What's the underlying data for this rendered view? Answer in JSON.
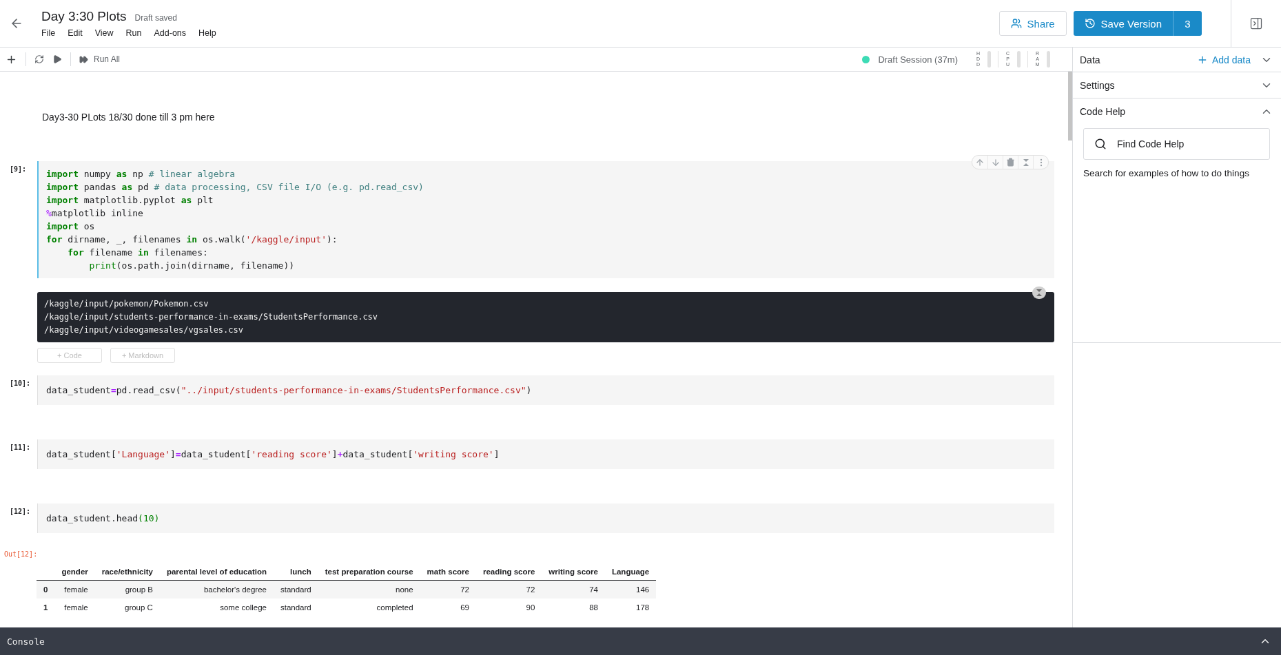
{
  "header": {
    "title": "Day 3:30 Plots",
    "status": "Draft saved",
    "menu": [
      "File",
      "Edit",
      "View",
      "Run",
      "Add-ons",
      "Help"
    ],
    "share": "Share",
    "save_version": "Save Version",
    "version_count": "3"
  },
  "toolbar": {
    "run_all": "Run All",
    "session": "Draft Session (37m)",
    "meters": [
      {
        "label": "HDD",
        "level": 0
      },
      {
        "label": "CPU",
        "level": 0
      },
      {
        "label": "RAM",
        "level": 0
      }
    ]
  },
  "cells": [
    {
      "kind": "markdown",
      "text": "Day3-30 PLots 18/30 done till 3 pm here"
    },
    {
      "kind": "code",
      "prompt": "[9]:",
      "active": true,
      "lines": [
        {
          "tokens": [
            {
              "kind": "kw",
              "text": "import"
            },
            {
              "kind": "p",
              "text": " numpy "
            },
            {
              "kind": "kw",
              "text": "as"
            },
            {
              "kind": "p",
              "text": " np "
            },
            {
              "kind": "c",
              "text": "# linear algebra"
            }
          ]
        },
        {
          "tokens": [
            {
              "kind": "kw",
              "text": "import"
            },
            {
              "kind": "p",
              "text": " pandas "
            },
            {
              "kind": "kw",
              "text": "as"
            },
            {
              "kind": "p",
              "text": " pd "
            },
            {
              "kind": "c",
              "text": "# data processing, CSV file I/O (e.g. pd.read_csv)"
            }
          ]
        },
        {
          "tokens": [
            {
              "kind": "kw",
              "text": "import"
            },
            {
              "kind": "p",
              "text": " matplotlib.pyplot "
            },
            {
              "kind": "kw",
              "text": "as"
            },
            {
              "kind": "p",
              "text": " plt"
            }
          ]
        },
        {
          "tokens": [
            {
              "kind": "m",
              "text": "%"
            },
            {
              "kind": "p",
              "text": "matplotlib inline"
            }
          ]
        },
        {
          "tokens": [
            {
              "kind": "kw",
              "text": "import"
            },
            {
              "kind": "p",
              "text": " os"
            }
          ]
        },
        {
          "tokens": [
            {
              "kind": "kw",
              "text": "for"
            },
            {
              "kind": "p",
              "text": " dirname, _, filenames "
            },
            {
              "kind": "kw",
              "text": "in"
            },
            {
              "kind": "p",
              "text": " os.walk("
            },
            {
              "kind": "s",
              "text": "'/kaggle/input'"
            },
            {
              "kind": "p",
              "text": "):"
            }
          ],
          "children": [
            {
              "tokens": [
                {
                  "kind": "kw",
                  "text": "for"
                },
                {
                  "kind": "p",
                  "text": " filename "
                },
                {
                  "kind": "kw",
                  "text": "in"
                },
                {
                  "kind": "p",
                  "text": " filenames:"
                }
              ],
              "children": [
                {
                  "tokens": [
                    {
                      "kind": "b",
                      "text": "print"
                    },
                    {
                      "kind": "p",
                      "text": "(os.path.join(dirname, filename))"
                    }
                  ]
                }
              ]
            }
          ]
        }
      ],
      "output": {
        "kind": "stream",
        "lines": [
          "/kaggle/input/pokemon/Pokemon.csv",
          "/kaggle/input/students-performance-in-exams/StudentsPerformance.csv",
          "/kaggle/input/videogamesales/vgsales.csv"
        ]
      },
      "add_buttons": [
        "+ Code",
        "+ Markdown"
      ]
    },
    {
      "kind": "code",
      "prompt": "[10]:",
      "active": false,
      "lines": [
        {
          "tokens": [
            {
              "kind": "p",
              "text": "data_student"
            },
            {
              "kind": "o",
              "text": "="
            },
            {
              "kind": "p",
              "text": "pd.read_csv("
            },
            {
              "kind": "s",
              "text": "\"../input/students-performance-in-exams/StudentsPerformance.csv\""
            },
            {
              "kind": "p",
              "text": ")"
            }
          ]
        }
      ]
    },
    {
      "kind": "code",
      "prompt": "[11]:",
      "active": false,
      "lines": [
        {
          "tokens": [
            {
              "kind": "p",
              "text": "data_student["
            },
            {
              "kind": "s",
              "text": "'Language'"
            },
            {
              "kind": "p",
              "text": "]"
            },
            {
              "kind": "o",
              "text": "="
            },
            {
              "kind": "p",
              "text": "data_student["
            },
            {
              "kind": "s",
              "text": "'reading score'"
            },
            {
              "kind": "p",
              "text": "]"
            },
            {
              "kind": "o",
              "text": "+"
            },
            {
              "kind": "p",
              "text": "data_student["
            },
            {
              "kind": "s",
              "text": "'writing score'"
            },
            {
              "kind": "p",
              "text": "]"
            }
          ]
        }
      ]
    },
    {
      "kind": "code",
      "prompt": "[12]:",
      "active": false,
      "lines": [
        {
          "tokens": [
            {
              "kind": "p",
              "text": "data_student.head"
            },
            {
              "kind": "n",
              "text": "(10)"
            }
          ]
        }
      ],
      "output": {
        "kind": "table",
        "prompt": "Out[12]:",
        "columns": [
          "",
          "gender",
          "race/ethnicity",
          "parental level of education",
          "lunch",
          "test preparation course",
          "math score",
          "reading score",
          "writing score",
          "Language"
        ],
        "rows": [
          [
            "0",
            "female",
            "group B",
            "bachelor's degree",
            "standard",
            "none",
            "72",
            "72",
            "74",
            "146"
          ],
          [
            "1",
            "female",
            "group C",
            "some college",
            "standard",
            "completed",
            "69",
            "90",
            "88",
            "178"
          ]
        ]
      }
    }
  ],
  "sidebar": {
    "sections": [
      {
        "title": "Data",
        "action": "Add data",
        "expanded": false
      },
      {
        "title": "Settings",
        "expanded": false
      },
      {
        "title": "Code Help",
        "expanded": true,
        "search_placeholder": "Find Code Help",
        "hint": "Search for examples of how to do things"
      }
    ]
  },
  "console": {
    "label": "Console",
    "expanded": false
  }
}
